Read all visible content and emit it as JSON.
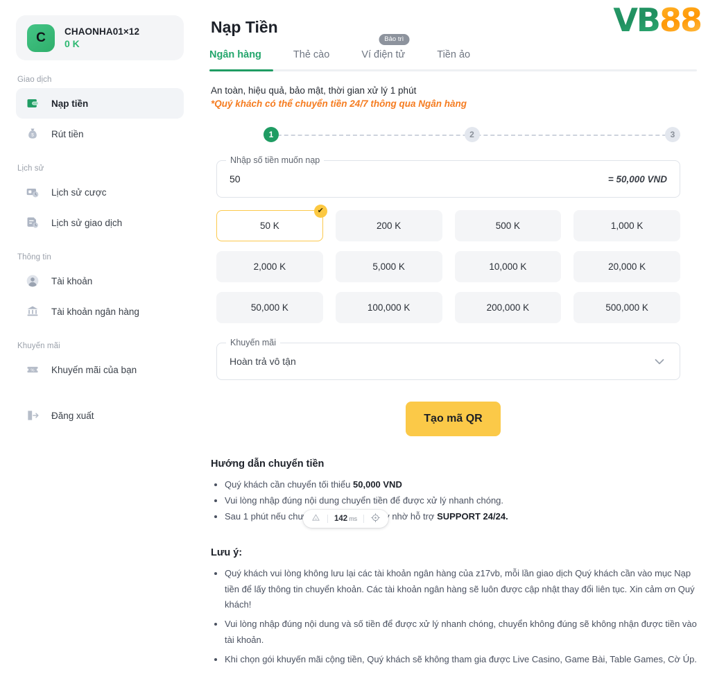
{
  "brand": {
    "logo_part1": "VB",
    "logo_part2": "88",
    "green": "#1f9c63",
    "yellow": "#fbc948",
    "orange": "#f57c20"
  },
  "sidebar": {
    "account": {
      "avatar_letter": "C",
      "name": "CHAONHA01×12",
      "balance": "0 K"
    },
    "groups": [
      {
        "title": "Giao dịch",
        "items": [
          {
            "label": "Nạp tiền",
            "icon": "wallet-icon",
            "active": true
          },
          {
            "label": "Rút tiền",
            "icon": "money-bag-icon",
            "active": false
          }
        ]
      },
      {
        "title": "Lịch sử",
        "items": [
          {
            "label": "Lịch sử cược",
            "icon": "bet-history-icon",
            "active": false
          },
          {
            "label": "Lịch sử giao dịch",
            "icon": "transaction-history-icon",
            "active": false
          }
        ]
      },
      {
        "title": "Thông tin",
        "items": [
          {
            "label": "Tài khoản",
            "icon": "user-icon",
            "active": false
          },
          {
            "label": "Tài khoản ngân hàng",
            "icon": "bank-icon",
            "active": false
          }
        ]
      },
      {
        "title": "Khuyến mãi",
        "items": [
          {
            "label": "Khuyến mãi của bạn",
            "icon": "ticket-icon",
            "active": false
          }
        ]
      }
    ],
    "logout": {
      "label": "Đăng xuất",
      "icon": "logout-icon"
    }
  },
  "main": {
    "page_title": "Nạp Tiền",
    "tabs": [
      {
        "label": "Ngân hàng",
        "active": true,
        "badge": ""
      },
      {
        "label": "Thẻ cào",
        "active": false,
        "badge": ""
      },
      {
        "label": "Ví điện tử",
        "active": false,
        "badge": "Bảo trì"
      },
      {
        "label": "Tiền ảo",
        "active": false,
        "badge": ""
      }
    ],
    "notice_line1": "An toàn, hiệu quả, bảo mật, thời gian xử lý 1 phút",
    "notice_line2": "*Quý khách có thể chuyển tiền 24/7 thông qua Ngân hàng",
    "steps": [
      {
        "number": "1",
        "state": "done"
      },
      {
        "number": "2",
        "state": "todo"
      },
      {
        "number": "3",
        "state": "todo"
      }
    ],
    "amount_field": {
      "legend": "Nhập số tiền muốn nạp",
      "value": "50",
      "placeholder": "Nhập số tiền muốn nạp",
      "converted": "= 50,000 VND"
    },
    "amount_options": [
      {
        "label": "50 K",
        "selected": true
      },
      {
        "label": "200 K",
        "selected": false
      },
      {
        "label": "500 K",
        "selected": false
      },
      {
        "label": "1,000 K",
        "selected": false
      },
      {
        "label": "2,000 K",
        "selected": false
      },
      {
        "label": "5,000 K",
        "selected": false
      },
      {
        "label": "10,000 K",
        "selected": false
      },
      {
        "label": "20,000 K",
        "selected": false
      },
      {
        "label": "50,000 K",
        "selected": false
      },
      {
        "label": "100,000 K",
        "selected": false
      },
      {
        "label": "200,000 K",
        "selected": false
      },
      {
        "label": "500,000 K",
        "selected": false
      }
    ],
    "check_glyph": "✔",
    "promo": {
      "legend": "Khuyến mãi",
      "value": "Hoàn trả vô tận"
    },
    "cta_label": "Tạo mã QR",
    "guide": {
      "title": "Hướng dẫn chuyển tiền",
      "items": [
        {
          "pre": "Quý khách cần chuyển tối thiểu ",
          "strong": "50,000 VND",
          "post": ""
        },
        {
          "pre": "Vui lòng nhập đúng nội dung chuyển tiền để được xử lý nhanh chóng.",
          "strong": "",
          "post": ""
        },
        {
          "pre": "Sau 1 phút nếu chưa nhận được tiền hãy nhờ hỗ trợ ",
          "strong": "SUPPORT 24/24.",
          "post": ""
        }
      ]
    },
    "notes": {
      "title": "Lưu ý:",
      "items": [
        "Quý khách vui lòng không lưu lại các tài khoản ngân hàng của z17vb, mỗi lần giao dịch Quý khách cần vào mục Nạp tiền để lấy thông tin chuyển khoản. Các tài khoản ngân hàng sẽ luôn được cập nhật thay đổi liên tục. Xin cảm ơn Quý khách!",
        "Vui lòng nhập đúng nội dung và số tiền để được xử lý nhanh chóng, chuyển không đúng sẽ không nhận được tiền vào tài khoản.",
        "Khi chọn gói khuyến mãi cộng tiền, Quý khách sẽ không tham gia được Live Casino, Game Bài, Table Games, Cờ Úp."
      ]
    }
  },
  "devtools": {
    "value": "142",
    "unit": "ms",
    "logo_icon": "nextjs-triangle-icon",
    "target_icon": "crosshair-icon"
  }
}
